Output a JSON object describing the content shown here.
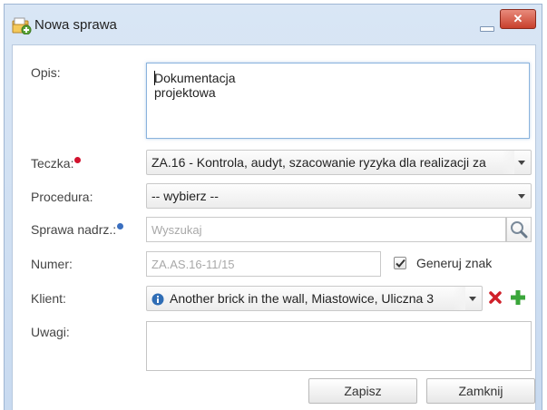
{
  "window": {
    "title": "Nowa sprawa"
  },
  "form": {
    "opis": {
      "label": "Opis:",
      "value": "Dokumentacja projektowa"
    },
    "teczka": {
      "label": "Teczka:",
      "value": "ZA.16 - Kontrola, audyt, szacowanie ryzyka dla realizacji za"
    },
    "procedura": {
      "label": "Procedura:",
      "value": "-- wybierz --"
    },
    "sprawa_nadrz": {
      "label": "Sprawa nadrz.:",
      "placeholder": "Wyszukaj"
    },
    "numer": {
      "label": "Numer:",
      "placeholder": "ZA.AS.16-11/15",
      "generuj_label": "Generuj znak",
      "generuj_checked": true
    },
    "klient": {
      "label": "Klient:",
      "value": "Another brick in the wall, Miastowice, Uliczna 3"
    },
    "uwagi": {
      "label": "Uwagi:",
      "value": ""
    }
  },
  "buttons": {
    "save": "Zapisz",
    "close": "Zamknij"
  },
  "colors": {
    "required_marker": "#d2122e",
    "info_marker": "#3a6fc0",
    "close_button": "#c8402c",
    "remove_icon": "#d0202a",
    "add_icon": "#3aa63a"
  }
}
